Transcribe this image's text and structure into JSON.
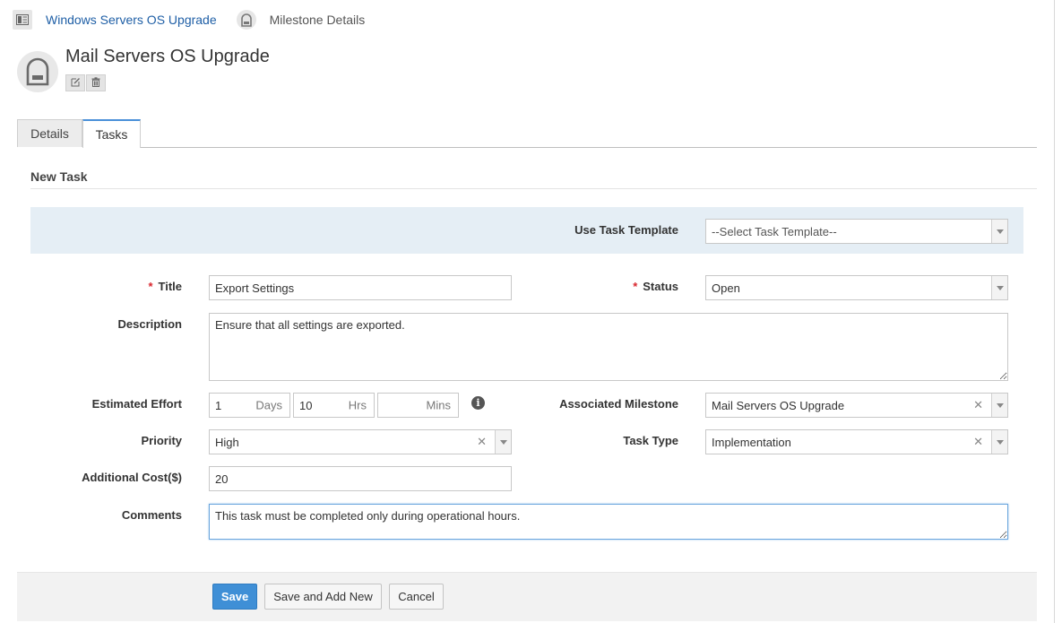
{
  "breadcrumb": {
    "parent_label": "Windows Servers OS Upgrade",
    "current_label": "Milestone Details"
  },
  "header": {
    "title": "Mail Servers OS Upgrade",
    "edit_icon": "edit-icon",
    "delete_icon": "trash-icon"
  },
  "tabs": [
    {
      "label": "Details",
      "active": false
    },
    {
      "label": "Tasks",
      "active": true
    }
  ],
  "section": {
    "title": "New Task"
  },
  "form": {
    "template": {
      "label": "Use Task Template",
      "value": "--Select Task Template--"
    },
    "title": {
      "label": "Title",
      "required_mark": "*",
      "value": "Export Settings"
    },
    "status": {
      "label": "Status",
      "required_mark": "*",
      "value": "Open"
    },
    "description": {
      "label": "Description",
      "value": "Ensure that all settings are exported."
    },
    "effort": {
      "label": "Estimated Effort",
      "days": {
        "value": "1",
        "unit": "Days"
      },
      "hrs": {
        "value": "10",
        "unit": "Hrs"
      },
      "mins": {
        "value": "",
        "unit": "Mins"
      },
      "info_icon": "i"
    },
    "milestone": {
      "label": "Associated Milestone",
      "value": "Mail Servers OS Upgrade"
    },
    "priority": {
      "label": "Priority",
      "value": "High"
    },
    "task_type": {
      "label": "Task Type",
      "value": "Implementation"
    },
    "cost": {
      "label": "Additional Cost($)",
      "value": "20"
    },
    "comments": {
      "label": "Comments",
      "value": "This task must be completed only during operational hours."
    }
  },
  "footer": {
    "save_label": "Save",
    "save_add_label": "Save and Add New",
    "cancel_label": "Cancel"
  },
  "colors": {
    "link": "#1f5fa6",
    "primary_button": "#3f8fd6",
    "required": "#d9262e",
    "template_band": "#e5eef5",
    "active_tab_accent": "#4a90d9"
  }
}
